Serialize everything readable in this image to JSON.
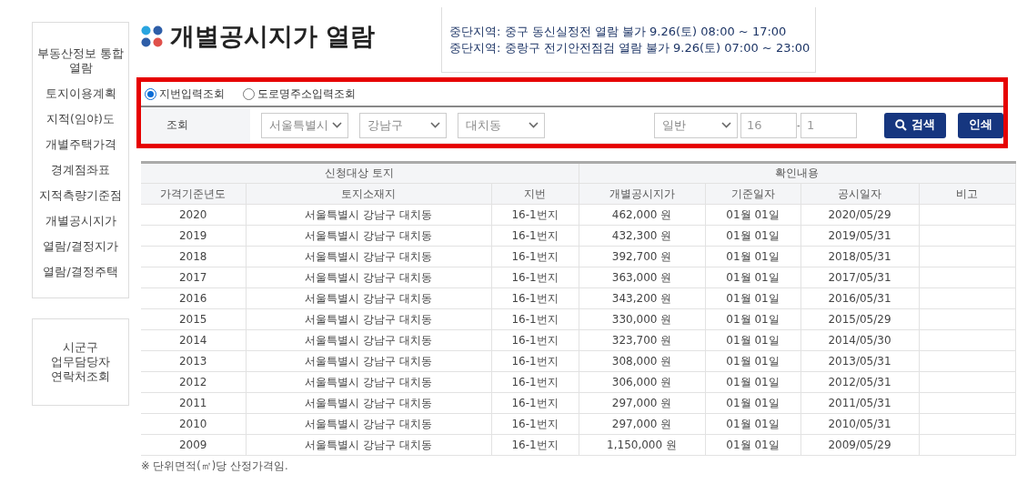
{
  "sidebar": {
    "items": [
      {
        "label": "부동산정보 통합 열람"
      },
      {
        "label": "토지이용계획"
      },
      {
        "label": "지적(임야)도"
      },
      {
        "label": "개별주택가격"
      },
      {
        "label": "경계점좌표"
      },
      {
        "label": "지적측량기준점"
      },
      {
        "label": "개별공시지가"
      },
      {
        "label": "열람/결정지가"
      },
      {
        "label": "열람/결정주택"
      }
    ],
    "contact": "시군구\n업무담당자\n연락처조회"
  },
  "page_title": "개별공시지가 열람",
  "notice": [
    "중단지역: 중구 동신실정전 열람 불가 9.26(토) 08:00 ~ 17:00",
    "중단지역: 중랑구 전기안전점검 열람 불가 9.26(토) 07:00 ~ 23:00"
  ],
  "search": {
    "highlighted": true,
    "modes": [
      {
        "label": "지번입력조회",
        "selected": true
      },
      {
        "label": "도로명주소입력조회",
        "selected": false
      }
    ],
    "row_label": "조회",
    "selects": [
      "서울특별시",
      "강남구",
      "대치동"
    ],
    "lot_type": "일반",
    "main_number": "16",
    "separator": "-",
    "sub_number": "1",
    "search_button": "검색",
    "print_button": "인쇄"
  },
  "table": {
    "groups": [
      {
        "label": "신청대상 토지"
      },
      {
        "label": "확인내용"
      }
    ],
    "columns": [
      "가격기준년도",
      "토지소재지",
      "지번",
      "개별공시지가",
      "기준일자",
      "공시일자",
      "비고"
    ],
    "rows": [
      [
        "2020",
        "서울특별시 강남구 대치동",
        "16-1번지",
        "462,000 원",
        "01월 01일",
        "2020/05/29"
      ],
      [
        "2019",
        "서울특별시 강남구 대치동",
        "16-1번지",
        "432,300 원",
        "01월 01일",
        "2019/05/31"
      ],
      [
        "2018",
        "서울특별시 강남구 대치동",
        "16-1번지",
        "392,700 원",
        "01월 01일",
        "2018/05/31"
      ],
      [
        "2017",
        "서울특별시 강남구 대치동",
        "16-1번지",
        "363,000 원",
        "01월 01일",
        "2017/05/31"
      ],
      [
        "2016",
        "서울특별시 강남구 대치동",
        "16-1번지",
        "343,200 원",
        "01월 01일",
        "2016/05/31"
      ],
      [
        "2015",
        "서울특별시 강남구 대치동",
        "16-1번지",
        "330,000 원",
        "01월 01일",
        "2015/05/29"
      ],
      [
        "2014",
        "서울특별시 강남구 대치동",
        "16-1번지",
        "323,700 원",
        "01월 01일",
        "2014/05/30"
      ],
      [
        "2013",
        "서울특별시 강남구 대치동",
        "16-1번지",
        "308,000 원",
        "01월 01일",
        "2013/05/31"
      ],
      [
        "2012",
        "서울특별시 강남구 대치동",
        "16-1번지",
        "306,000 원",
        "01월 01일",
        "2012/05/31"
      ],
      [
        "2011",
        "서울특별시 강남구 대치동",
        "16-1번지",
        "297,000 원",
        "01월 01일",
        "2011/05/31"
      ],
      [
        "2010",
        "서울특별시 강남구 대치동",
        "16-1번지",
        "297,000 원",
        "01월 01일",
        "2010/05/31"
      ],
      [
        "2009",
        "서울특별시 강남구 대치동",
        "16-1번지",
        "1,150,000 원",
        "01월 01일",
        "2009/05/29"
      ]
    ]
  },
  "footnote": "※ 단위면적(㎡)당 산정가격임."
}
